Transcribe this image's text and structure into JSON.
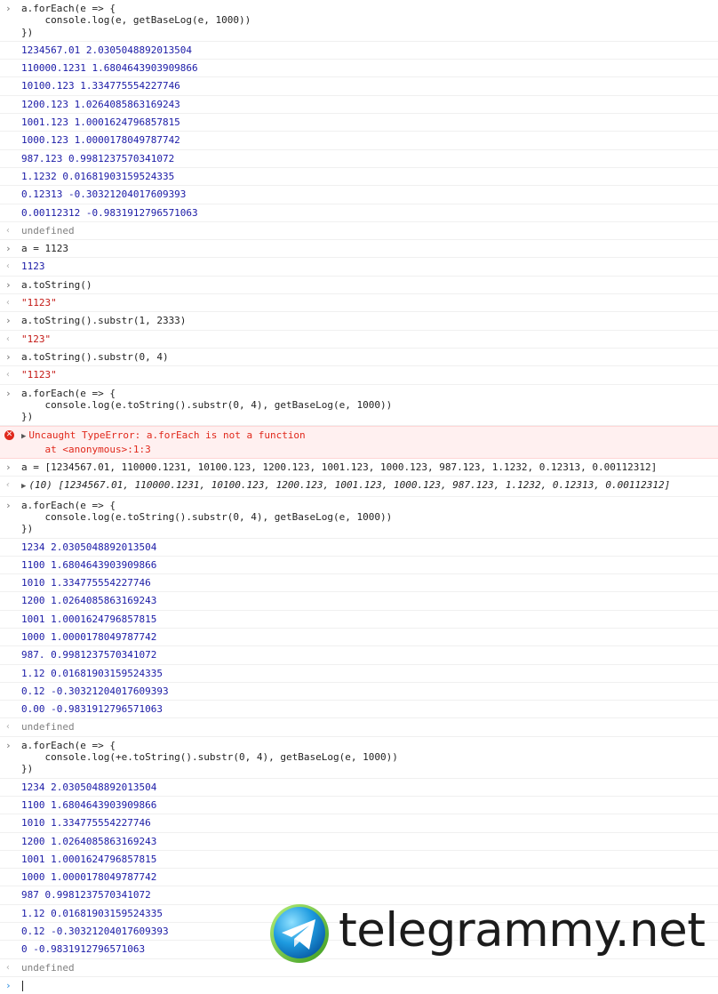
{
  "console": {
    "b1_input": "a.forEach(e => {\n    console.log(e, getBaseLog(e, 1000))\n})",
    "b1_logs": [
      "1234567.01 2.0305048892013504",
      "110000.1231 1.6804643903909866",
      "10100.123 1.334775554227746",
      "1200.123 1.0264085863169243",
      "1001.123 1.0001624796857815",
      "1000.123 1.0000178049787742",
      "987.123 0.9981237570341072",
      "1.1232 0.01681903159524335",
      "0.12313 -0.30321204017609393",
      "0.00112312 -0.9831912796571063"
    ],
    "b1_return": "undefined",
    "b2_input": "a = 1123",
    "b2_return": "1123",
    "b3_input": "a.toString()",
    "b3_return": "\"1123\"",
    "b4_input": "a.toString().substr(1, 2333)",
    "b4_return": "\"123\"",
    "b5_input": "a.toString().substr(0, 4)",
    "b5_return": "\"1123\"",
    "b6_input": "a.forEach(e => {\n    console.log(e.toString().substr(0, 4), getBaseLog(e, 1000))\n})",
    "b6_error": "Uncaught TypeError: a.forEach is not a function\n    at <anonymous>:1:3",
    "b7_input": "a = [1234567.01, 110000.1231, 10100.123, 1200.123, 1001.123, 1000.123, 987.123, 1.1232, 0.12313, 0.00112312]",
    "b7_return": "(10) [1234567.01, 110000.1231, 10100.123, 1200.123, 1001.123, 1000.123, 987.123, 1.1232, 0.12313, 0.00112312]",
    "b8_input": "a.forEach(e => {\n    console.log(e.toString().substr(0, 4), getBaseLog(e, 1000))\n})",
    "b8_logs": [
      "1234 2.0305048892013504",
      "1100 1.6804643903909866",
      "1010 1.334775554227746",
      "1200 1.0264085863169243",
      "1001 1.0001624796857815",
      "1000 1.0000178049787742",
      "987. 0.9981237570341072",
      "1.12 0.01681903159524335",
      "0.12 -0.30321204017609393",
      "0.00 -0.9831912796571063"
    ],
    "b8_return": "undefined",
    "b9_input": "a.forEach(e => {\n    console.log(+e.toString().substr(0, 4), getBaseLog(e, 1000))\n})",
    "b9_logs": [
      "1234 2.0305048892013504",
      "1100 1.6804643903909866",
      "1010 1.334775554227746",
      "1200 1.0264085863169243",
      "1001 1.0001624796857815",
      "1000 1.0000178049787742",
      "987 0.9981237570341072",
      "1.12 0.01681903159524335",
      "0.12 -0.30321204017609393",
      "0 -0.9831912796571063"
    ],
    "b9_return": "undefined"
  },
  "watermark": {
    "text": "telegrammy.net"
  },
  "colors": {
    "log_text": "#1a1aa6",
    "string_text": "#c41a16",
    "error_text": "#e0281b",
    "error_bg": "#fff0f0",
    "muted": "#808080"
  }
}
